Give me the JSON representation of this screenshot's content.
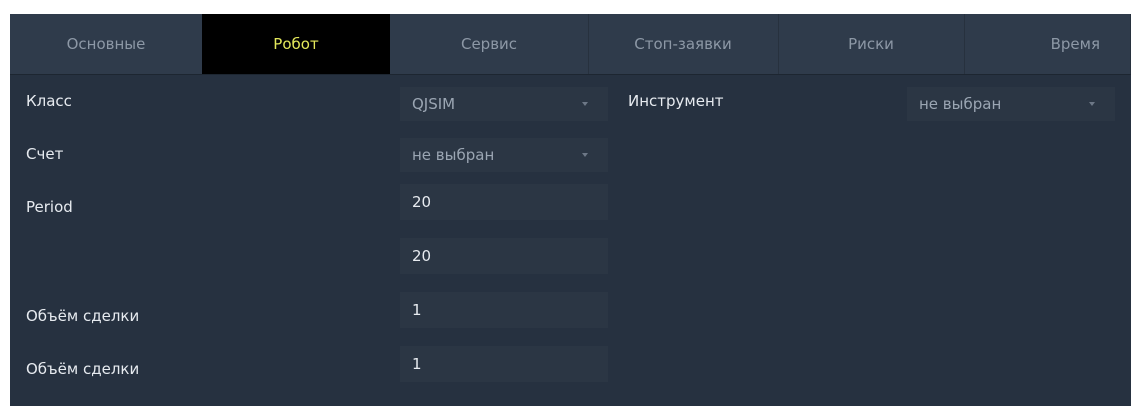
{
  "tabs": [
    "Основные",
    "Робот",
    "Сервис",
    "Стоп-заявки",
    "Риски",
    "Время"
  ],
  "active_tab": "Робот",
  "colors": {
    "background": "#263140",
    "tabbar": "#2f3b4b",
    "active_tab_bg": "#000000",
    "active_tab_text": "#e4e85b",
    "field_bg": "#2b3644"
  },
  "fields": {
    "class": {
      "label": "Класс",
      "value": "QJSIM"
    },
    "instrument": {
      "label": "Инструмент",
      "value": "не выбран"
    },
    "account": {
      "label": "Счет",
      "value": "не выбран"
    },
    "period": {
      "label": "Period",
      "value": "20"
    },
    "period2": {
      "value": "20"
    },
    "volume1": {
      "label": "Объём сделки",
      "value": "1"
    },
    "volume2": {
      "label": "Объём сделки",
      "value": "1"
    }
  },
  "icons": {
    "dropdown": "chevron-down-icon"
  }
}
